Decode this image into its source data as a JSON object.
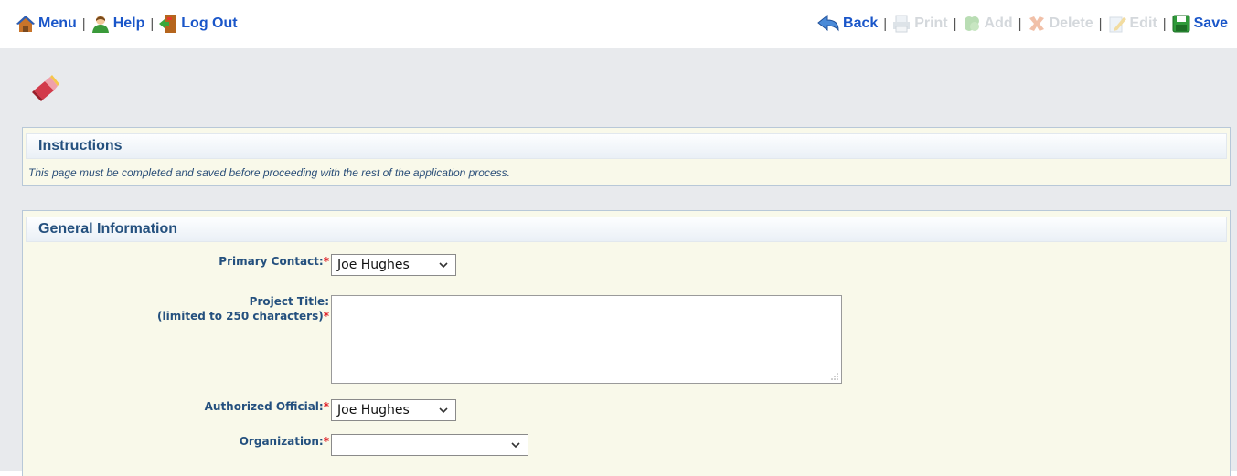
{
  "toolbar": {
    "menu_label": "Menu",
    "help_label": "Help",
    "logout_label": "Log Out",
    "back_label": "Back",
    "print_label": "Print",
    "add_label": "Add",
    "delete_label": "Delete",
    "edit_label": "Edit",
    "save_label": "Save",
    "separator": "|"
  },
  "instructions": {
    "heading": "Instructions",
    "text": "This page must be completed and saved before proceeding with the rest of the application process."
  },
  "general": {
    "heading": "General Information",
    "required_mark": "*",
    "primary_contact_label": "Primary Contact:",
    "primary_contact_value": "Joe Hughes",
    "project_title_label_line1": "Project Title:",
    "project_title_label_line2": "(limited to 250 characters)",
    "project_title_value": "",
    "authorized_official_label": "Authorized Official:",
    "authorized_official_value": "Joe Hughes",
    "organization_label": "Organization:",
    "organization_value": ""
  },
  "colors": {
    "link": "#1a56c9",
    "disabled": "#d4d8dc",
    "heading": "#24507e",
    "required": "#e0242a",
    "panel_bg": "#f9f9ea",
    "page_bg": "#e8eaed"
  },
  "icons": {
    "menu": "home-icon",
    "help": "help-person-icon",
    "logout": "door-exit-icon",
    "back": "back-arrow-icon",
    "print": "printer-icon",
    "add": "add-icon",
    "delete": "delete-x-icon",
    "edit": "edit-pencil-icon",
    "save": "floppy-disk-icon",
    "page": "eraser-icon"
  }
}
